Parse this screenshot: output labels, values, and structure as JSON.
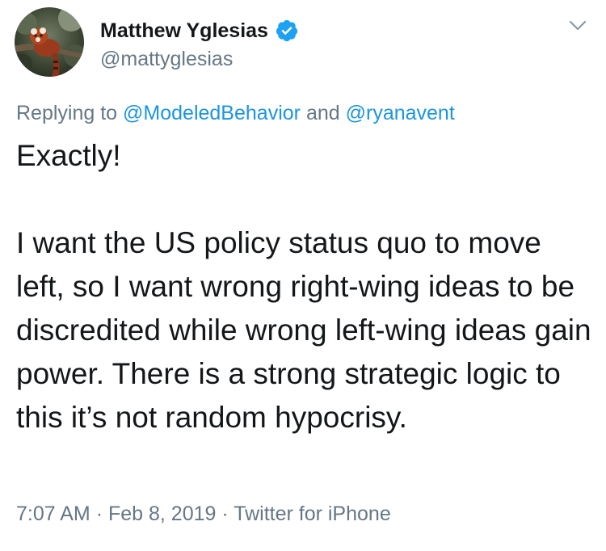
{
  "author": {
    "display_name": "Matthew Yglesias",
    "handle": "@mattyglesias",
    "verified_icon": "verified-badge-icon",
    "avatar": "red-panda-avatar"
  },
  "menu": {
    "icon": "chevron-down-icon"
  },
  "reply": {
    "prefix": "Replying to",
    "mention_1": "@ModeledBehavior",
    "connector": "and",
    "mention_2": "@ryanavent"
  },
  "tweet": {
    "text": "Exactly!\n\nI want the US policy status quo to move left, so I want wrong right-wing ideas to be discredited while wrong left-wing ideas gain power. There is a strong strategic logic to this it’s not random hypocrisy."
  },
  "meta": {
    "time": "7:07 AM",
    "separator": "·",
    "date": "Feb 8, 2019",
    "source": "Twitter for iPhone"
  },
  "colors": {
    "text": "#14171a",
    "secondary": "#657786",
    "link": "#1b95e0",
    "verified": "#1da1f2"
  }
}
